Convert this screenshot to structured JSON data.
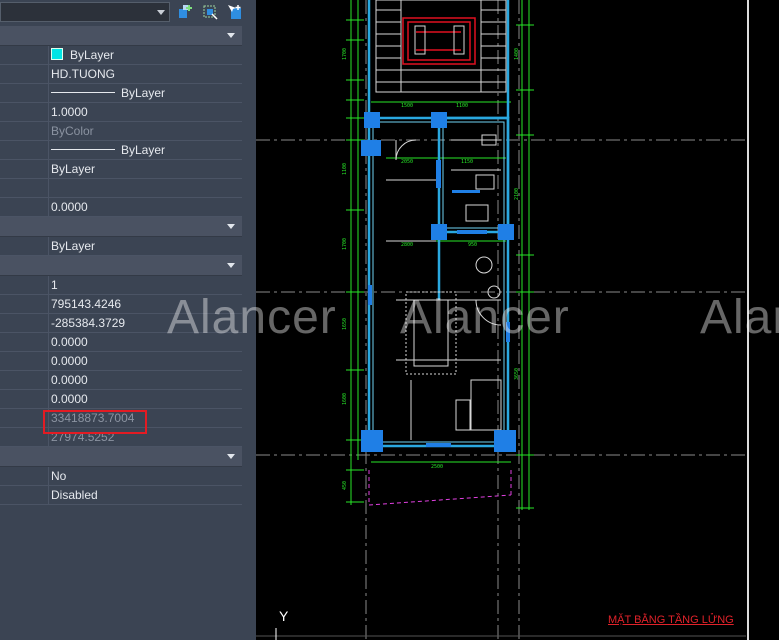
{
  "properties": {
    "sections": [
      {
        "rows": [
          {
            "value": "ByLayer",
            "kind": "color",
            "swatch": "#00e5e5"
          },
          {
            "value": "HD.TUONG"
          },
          {
            "value": "ByLayer",
            "kind": "linetype"
          },
          {
            "value": "1.0000"
          },
          {
            "value": "ByColor",
            "dim": true
          },
          {
            "value": "ByLayer",
            "kind": "linetype"
          },
          {
            "value": "ByLayer"
          },
          {
            "value": ""
          },
          {
            "value": "0.0000"
          }
        ]
      },
      {
        "rows": [
          {
            "value": "ByLayer"
          }
        ]
      },
      {
        "rows": [
          {
            "value": "1"
          },
          {
            "value": "795143.4246"
          },
          {
            "value": "-285384.3729"
          },
          {
            "value": "0.0000"
          },
          {
            "value": "0.0000"
          },
          {
            "value": "0.0000"
          },
          {
            "value": "0.0000"
          },
          {
            "value": "33418873.7004",
            "dim": true,
            "highlighted": true
          },
          {
            "value": "27974.5252",
            "dim": true
          }
        ]
      },
      {
        "rows": [
          {
            "value": "No"
          },
          {
            "value": "Disabled"
          }
        ]
      }
    ]
  },
  "toolbar": {
    "icons": [
      "quick-select-icon",
      "select-objects-icon",
      "toggle-pickadd-icon"
    ]
  },
  "drawing": {
    "watermark": "Alancer",
    "plan_title": "MẶT BẰNG TẦNG LỬNG",
    "ucs_label": "Y",
    "colors": {
      "wall": "#2aa8e0",
      "column": "#1f7fe6",
      "dim": "#27e627",
      "furniture": "#d7d7d7",
      "red": "#e01020",
      "magenta": "#e040e0"
    }
  }
}
